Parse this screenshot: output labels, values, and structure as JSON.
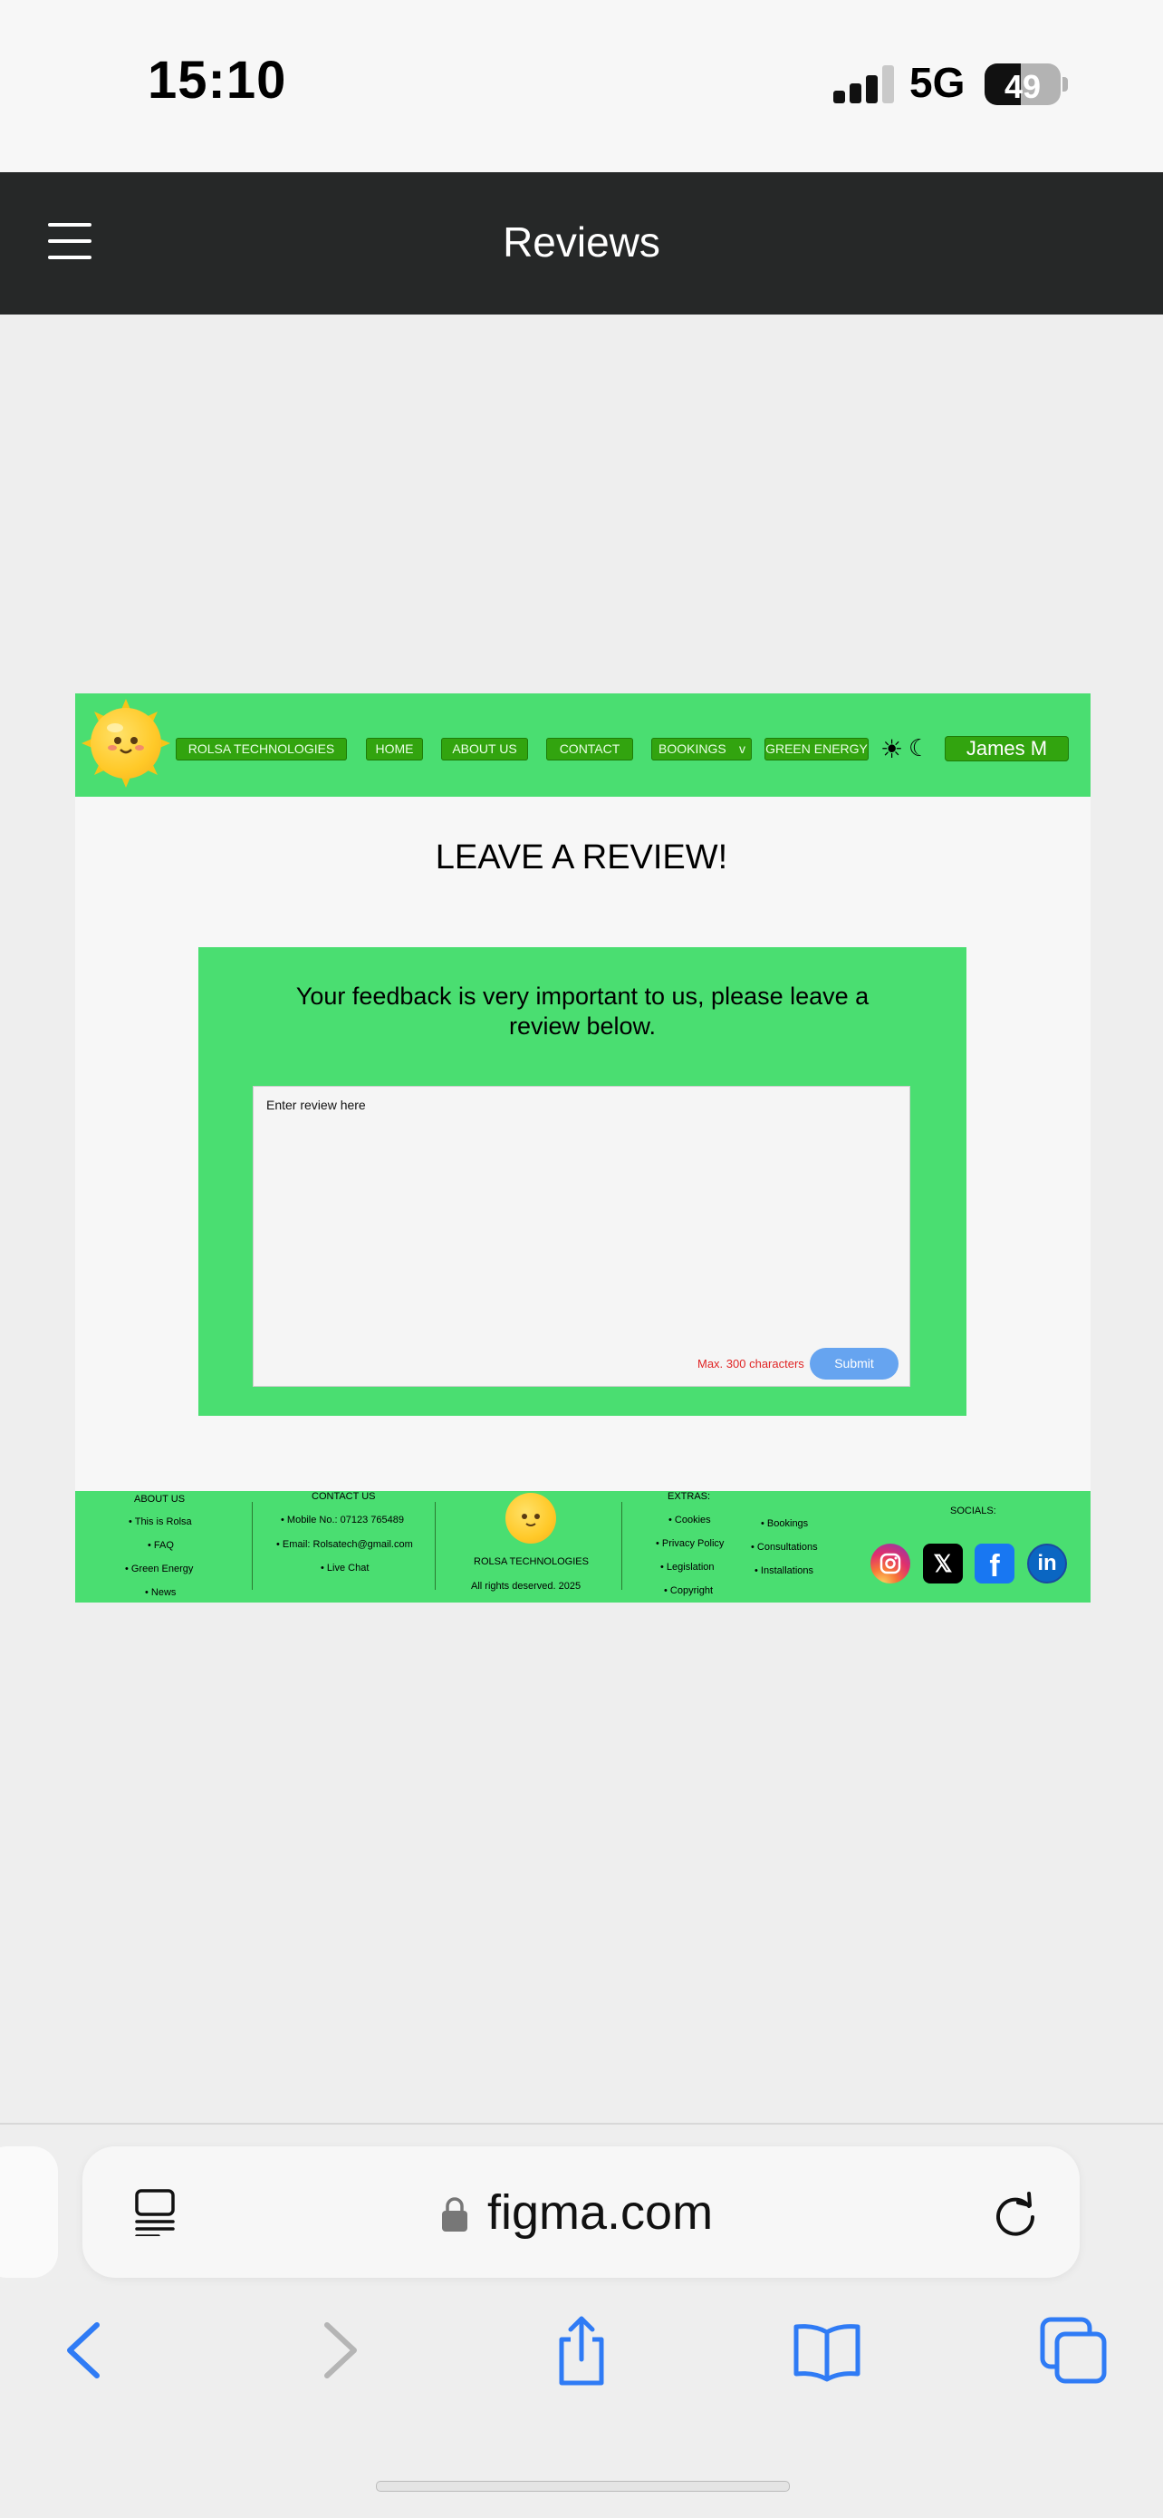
{
  "status_bar": {
    "time": "15:10",
    "network": "5G",
    "battery": "49"
  },
  "app_header": {
    "title": "Reviews"
  },
  "site_nav": {
    "brand": "ROLSA TECHNOLOGIES",
    "links": [
      "HOME",
      "ABOUT US",
      "CONTACT",
      "BOOKINGS",
      "GREEN ENERGY"
    ],
    "dropdown_caret": "v",
    "user": "James M"
  },
  "main": {
    "heading": "LEAVE A REVIEW!",
    "prompt": "Your feedback is very important to us, please leave a review below.",
    "review_placeholder": "Enter review here",
    "max_chars": "Max. 300 characters",
    "submit": "Submit"
  },
  "footer": {
    "about": {
      "title": "ABOUT US",
      "items": [
        "This is Rolsa",
        "FAQ",
        "Green Energy",
        "News"
      ]
    },
    "contact": {
      "title": "CONTACT US",
      "items": [
        "Mobile No.: 07123 765489",
        "Email: Rolsatech@gmail.com",
        "Live Chat"
      ]
    },
    "brand": "ROLSA TECHNOLOGIES",
    "rights": "All rights deserved. 2025",
    "extras": {
      "title": "EXTRAS:",
      "col1": [
        "Cookies",
        "Privacy Policy",
        "Legislation",
        "Copyright"
      ],
      "col2": [
        "Bookings",
        "Consultations",
        "Installations"
      ]
    },
    "socials": {
      "title": "SOCIALS:",
      "icons": [
        "instagram-icon",
        "x-icon",
        "facebook-icon",
        "linkedin-icon"
      ]
    }
  },
  "browser": {
    "url": "figma.com"
  },
  "colors": {
    "nav_green": "#4ade71",
    "button_green": "#32a40f",
    "submit_blue": "#66a4f0",
    "header_dark": "#262828",
    "warning_red": "#e02424"
  }
}
